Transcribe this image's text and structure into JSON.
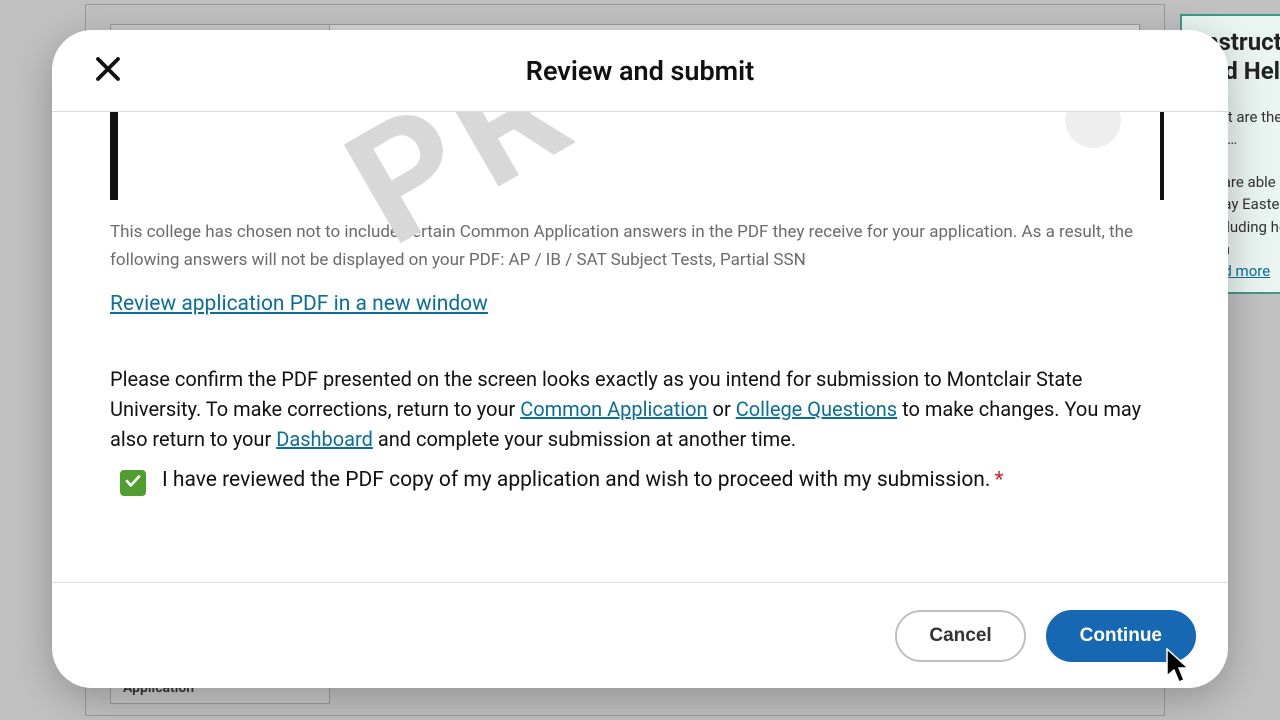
{
  "background": {
    "help_title": "Instructions and Help",
    "help_q": "What are the Student chat…",
    "help_body": "We are able Monday-Friday Eastern Time (excluding holidays) from",
    "help_link": "Read more",
    "app_label": "Application"
  },
  "modal": {
    "title": "Review and submit",
    "notice": "This college has chosen not to include certain Common Application answers in the PDF they receive for your application. As a result, the following answers will not be displayed on your PDF: AP / IB / SAT Subject Tests, Partial SSN",
    "review_link": "Review application PDF in a new window",
    "confirm_pre": "Please confirm the PDF presented on the screen looks exactly as you intend for submission to Montclair State University. To make corrections, return to your ",
    "link_common": "Common Application",
    "confirm_or": " or ",
    "link_college": "College Questions",
    "confirm_mid": " to make changes. You may also return to your ",
    "link_dashboard": "Dashboard",
    "confirm_post": " and complete your submission at another time.",
    "checkbox_label": "I have reviewed the PDF copy of my application and wish to proceed with my submission.",
    "checkbox_checked": true,
    "cancel_label": "Cancel",
    "continue_label": "Continue"
  }
}
